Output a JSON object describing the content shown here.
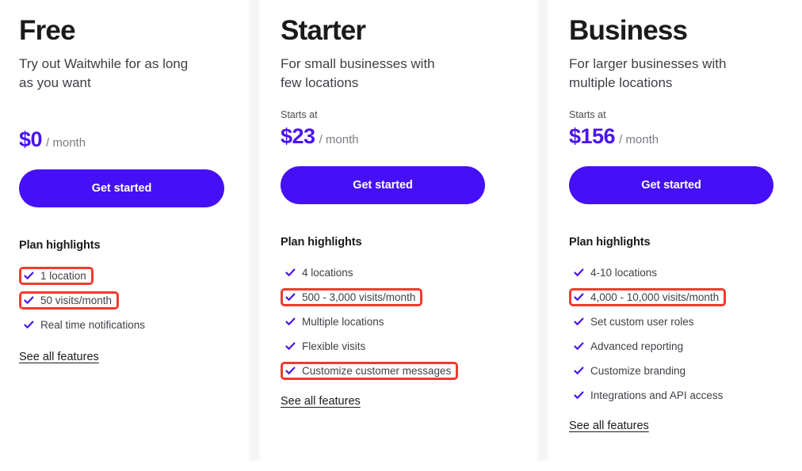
{
  "theme": {
    "accent": "#4510f5",
    "price_color": "#4a14f0",
    "highlight_border": "#ef3b30",
    "heading_color": "#1b1b1d",
    "body_color": "#3f3f46",
    "muted_color": "#7a7a82",
    "background": "#ffffff"
  },
  "plans": [
    {
      "name": "Free",
      "tagline": "Try out Waitwhile for as long as you want",
      "starts_at_label": "",
      "price": "$0",
      "period": "/ month",
      "cta_label": "Get started",
      "highlights_title": "Plan highlights",
      "features": [
        {
          "label": "1 location",
          "icon": "check-icon",
          "highlighted": false
        },
        {
          "label": "50 visits/month",
          "icon": "check-icon",
          "highlighted": true
        },
        {
          "label": "Real time notifications",
          "icon": "check-icon",
          "highlighted": false
        }
      ],
      "see_all_label": "See all features"
    },
    {
      "name": "Starter",
      "tagline": "For small businesses with few locations",
      "starts_at_label": "Starts at",
      "price": "$23",
      "period": "/ month",
      "cta_label": "Get started",
      "highlights_title": "Plan highlights",
      "features": [
        {
          "label": "4 locations",
          "icon": "check-icon",
          "highlighted": false
        },
        {
          "label": "500 - 3,000 visits/month",
          "icon": "check-icon",
          "highlighted": true
        },
        {
          "label": "Multiple locations",
          "icon": "check-icon",
          "highlighted": false
        },
        {
          "label": "Flexible visits",
          "icon": "check-icon",
          "highlighted": false
        },
        {
          "label": "Customize customer messages",
          "icon": "check-icon",
          "highlighted": true
        }
      ],
      "see_all_label": "See all features"
    },
    {
      "name": "Business",
      "tagline": "For larger businesses with multiple locations",
      "starts_at_label": "Starts at",
      "price": "$156",
      "period": "/ month",
      "cta_label": "Get started",
      "highlights_title": "Plan highlights",
      "features": [
        {
          "label": "4-10 locations",
          "icon": "check-icon",
          "highlighted": false
        },
        {
          "label": "4,000 - 10,000 visits/month",
          "icon": "check-icon",
          "highlighted": true
        },
        {
          "label": "Set custom user roles",
          "icon": "check-icon",
          "highlighted": false
        },
        {
          "label": "Advanced reporting",
          "icon": "check-icon",
          "highlighted": false
        },
        {
          "label": "Customize branding",
          "icon": "check-icon",
          "highlighted": false
        },
        {
          "label": "Integrations and API access",
          "icon": "check-icon",
          "highlighted": false
        }
      ],
      "see_all_label": "See all features"
    }
  ]
}
